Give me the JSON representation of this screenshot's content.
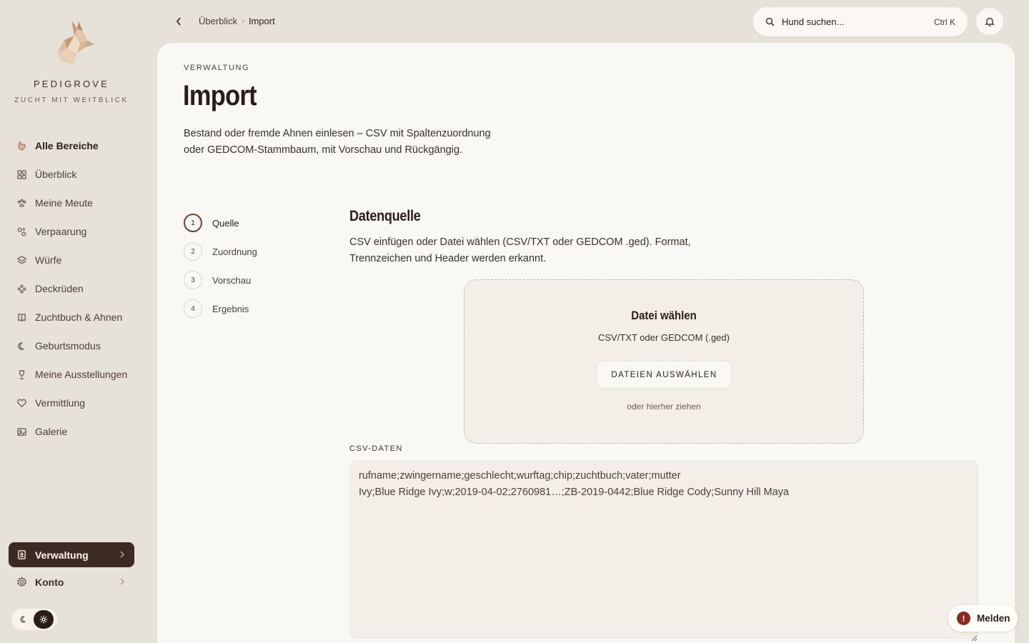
{
  "brand": {
    "name": "PEDIGROVE",
    "tagline": "ZUCHT MIT WEITBLICK"
  },
  "sidebar": {
    "items": [
      {
        "label": "Alle Bereiche",
        "icon": "dog-icon"
      },
      {
        "label": "Überblick",
        "icon": "grid-icon"
      },
      {
        "label": "Meine Meute",
        "icon": "paw-icon"
      },
      {
        "label": "Verpaarung",
        "icon": "pairing-icon"
      },
      {
        "label": "Würfe",
        "icon": "layers-icon"
      },
      {
        "label": "Deckrüden",
        "icon": "male-dog-icon"
      },
      {
        "label": "Zuchtbuch & Ahnen",
        "icon": "book-icon"
      },
      {
        "label": "Geburtsmodus",
        "icon": "moon-icon"
      },
      {
        "label": "Meine Ausstellungen",
        "icon": "trophy-icon"
      },
      {
        "label": "Vermittlung",
        "icon": "heart-icon"
      },
      {
        "label": "Galerie",
        "icon": "image-icon"
      }
    ],
    "admin_label": "Verwaltung",
    "account_label": "Konto"
  },
  "topbar": {
    "breadcrumb_root": "Überblick",
    "breadcrumb_current": "Import",
    "search_placeholder": "Hund suchen...",
    "search_shortcut": "Ctrl K"
  },
  "page": {
    "kicker": "VERWALTUNG",
    "title": "Import",
    "intro": "Bestand oder fremde Ahnen einlesen – CSV mit Spaltenzuordnung oder GEDCOM-Stammbaum, mit Vorschau und Rückgängig."
  },
  "steps": [
    {
      "num": "1",
      "label": "Quelle",
      "active": true
    },
    {
      "num": "2",
      "label": "Zuordnung",
      "active": false
    },
    {
      "num": "3",
      "label": "Vorschau",
      "active": false
    },
    {
      "num": "4",
      "label": "Ergebnis",
      "active": false
    }
  ],
  "source": {
    "title": "Datenquelle",
    "description": "CSV einfügen oder Datei wählen (CSV/TXT oder GEDCOM .ged). Format, Trennzeichen und Header werden erkannt.",
    "dropzone": {
      "title": "Datei wählen",
      "subtitle": "CSV/TXT oder GEDCOM (.ged)",
      "button": "DATEIEN AUSWÄHLEN",
      "hint": "oder hierher ziehen"
    },
    "csv_label": "CSV-DATEN",
    "csv_lines": [
      "rufname;zwingername;geschlecht;wurftag;chip;zuchtbuch;vater;mutter",
      "Ivy;Blue Ridge Ivy;w;2019-04-02;2760981…;ZB-2019-0442;Blue Ridge Cody;Sunny Hill Maya"
    ]
  },
  "report": {
    "icon_text": "!",
    "label": "Melden"
  },
  "colors": {
    "accent": "#3d2a22",
    "step_active": "#7a3c2a",
    "alert": "#8a2a1e",
    "background": "#e6e1d9",
    "panel": "#faf8f4"
  }
}
